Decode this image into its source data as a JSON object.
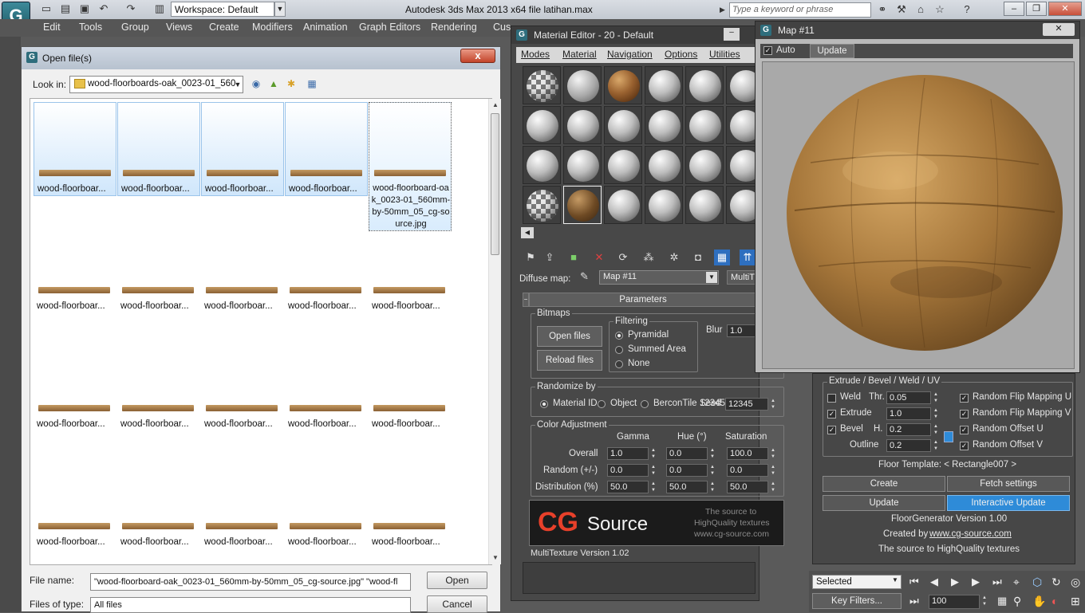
{
  "app": {
    "title": "Autodesk 3ds Max  2013 x64      file latihan.max",
    "logo_glyph": "G",
    "workspace": "Workspace: Default",
    "search_placeholder": "Type a keyword or phrase",
    "toolbar_icons": [
      "new-file-icon",
      "open-folder-icon",
      "save-icon",
      "undo-icon",
      "redo-icon",
      "project-folder-icon"
    ]
  },
  "menubar": {
    "items": [
      "Edit",
      "Tools",
      "Group",
      "Views",
      "Create",
      "Modifiers",
      "Animation",
      "Graph Editors",
      "Rendering",
      "Cus"
    ]
  },
  "open_dialog": {
    "title": "Open file(s)",
    "lookin_label": "Look in:",
    "lookin_value": "wood-floorboards-oak_0023-01_560",
    "selected_thumb_label": "wood-floorboard-oak_0023-01_560mm-by-50mm_05_cg-source.jpg",
    "thumb_label": "wood-floorboar...",
    "filename_label": "File name:",
    "filename_value": "\"wood-floorboard-oak_0023-01_560mm-by-50mm_05_cg-source.jpg\" \"wood-fl",
    "filetype_label": "Files of type:",
    "filetype_value": "All files",
    "open_button": "Open",
    "cancel_button": "Cancel",
    "close_glyph": "x"
  },
  "material_editor": {
    "title": "Material Editor - 20 - Default",
    "menus": [
      "Modes",
      "Material",
      "Navigation",
      "Options",
      "Utilities"
    ],
    "diffuse_label": "Diffuse map:",
    "diffuse_value": "Map #11",
    "multitex_label": "MultiT",
    "params_title": "Parameters",
    "bitmaps_label": "Bitmaps",
    "open_files": "Open files",
    "reload_files": "Reload files",
    "filtering_label": "Filtering",
    "filter_pyramidal": "Pyramidal",
    "filter_summed": "Summed Area",
    "filter_none": "None",
    "blur_label": "Blur",
    "blur_value": "1.0",
    "randomize_label": "Randomize by",
    "rand_material_id": "Material ID",
    "rand_object": "Object",
    "rand_bercon": "BerconTile",
    "seed_label": "Seed",
    "seed_value": "12345",
    "color_adj_label": "Color Adjustment",
    "col_gamma": "Gamma",
    "col_hue": "Hue (°)",
    "col_saturation": "Saturation",
    "row_overall": "Overall",
    "row_random": "Random (+/-)",
    "row_distribution": "Distribution (%)",
    "overall_gamma": "1.0",
    "overall_hue": "0.0",
    "overall_sat": "100.0",
    "random_gamma": "0.0",
    "random_hue": "0.0",
    "random_sat": "0.0",
    "dist_gamma": "50.0",
    "dist_hue": "50.0",
    "dist_sat": "50.0",
    "cg_logo_cg": "CG",
    "cg_logo_source": "Source",
    "cg_tag1": "The source to",
    "cg_tag2": "HighQuality textures",
    "cg_tag3": "www.cg-source.com",
    "version": "MultiTexture Version 1.02"
  },
  "map_window": {
    "title": "Map #11",
    "auto_label": "Auto",
    "update_label": "Update"
  },
  "floor_generator": {
    "group_label": "Extrude / Bevel / Weld / UV",
    "weld": "Weld",
    "thr_label": "Thr.",
    "thr_value": "0.05",
    "extrude": "Extrude",
    "extrude_value": "1.0",
    "bevel": "Bevel",
    "h_label": "H.",
    "h_value": "0.2",
    "outline": "Outline",
    "outline_value": "0.2",
    "flip_u": "Random Flip Mapping U",
    "flip_v": "Random Flip Mapping V",
    "offset_u": "Random Offset U",
    "offset_v": "Random Offset V",
    "template": "Floor Template: < Rectangle007 >",
    "create": "Create",
    "fetch": "Fetch settings",
    "update": "Update",
    "interactive_update": "Interactive Update",
    "version": "FloorGenerator Version 1.00",
    "created_by_prefix": "Created by",
    "created_by_link": "www.cg-source.com",
    "tagline": "The source to HighQuality textures"
  },
  "bottom_bar": {
    "selection": "Selected",
    "key_filters": "Key Filters...",
    "frame_value": "100"
  },
  "colors": {
    "interactive_update_bg": "#2e8bd8",
    "cg_red": "#e8402a",
    "selection_blue": "#cfe6fb"
  }
}
